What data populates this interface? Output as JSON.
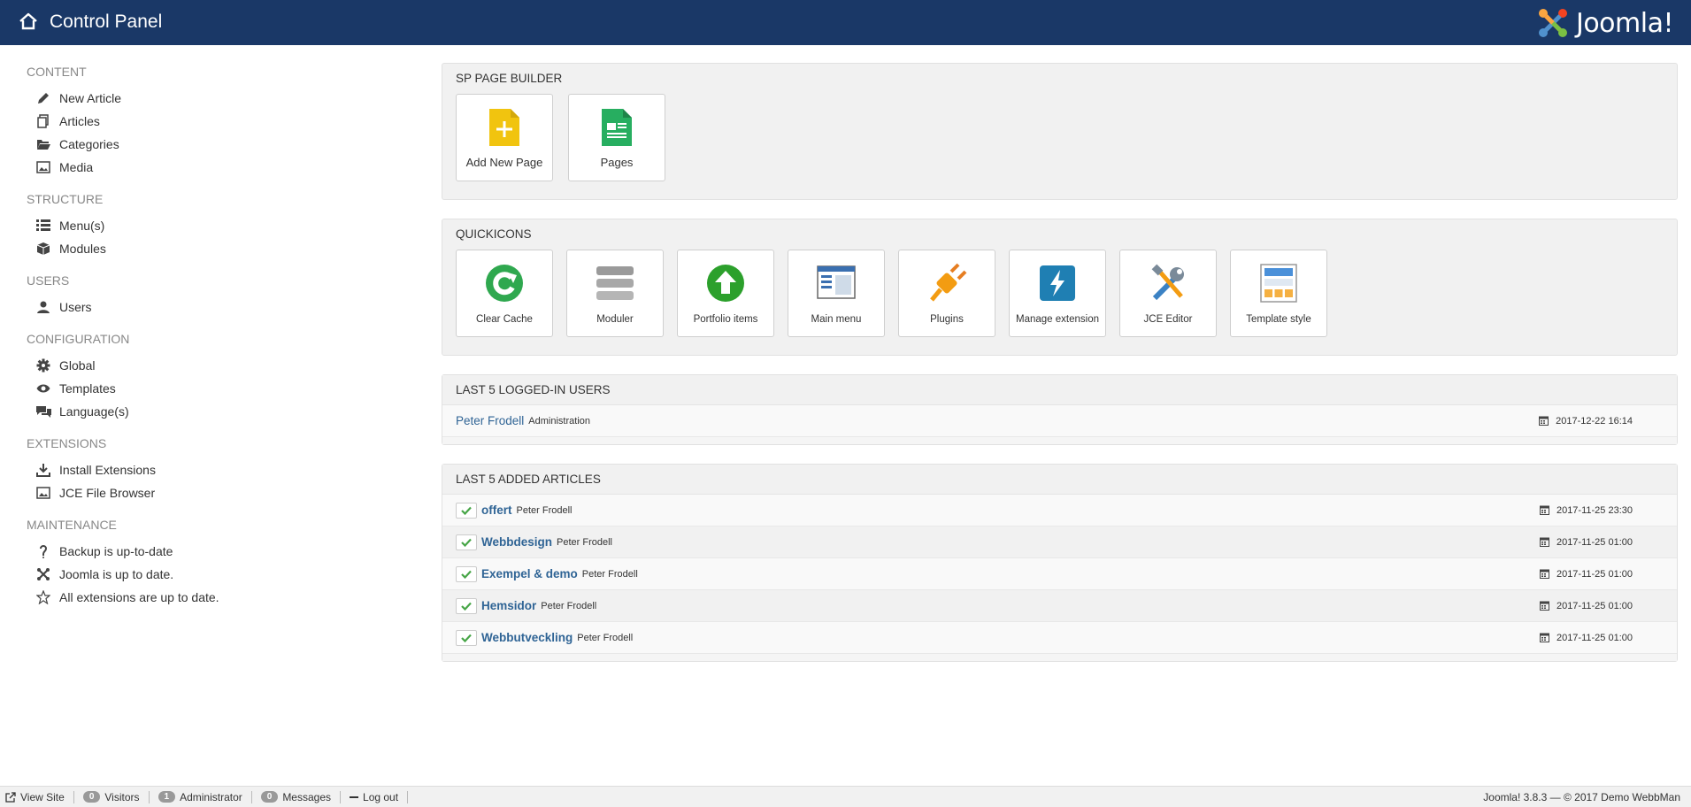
{
  "header": {
    "title": "Control Panel",
    "logo_text": "Joomla!"
  },
  "sidebar": {
    "sections": [
      {
        "title": "CONTENT",
        "items": [
          {
            "label": "New Article",
            "icon": "pencil-icon"
          },
          {
            "label": "Articles",
            "icon": "copy-icon"
          },
          {
            "label": "Categories",
            "icon": "folder-icon"
          },
          {
            "label": "Media",
            "icon": "image-icon"
          }
        ]
      },
      {
        "title": "STRUCTURE",
        "items": [
          {
            "label": "Menu(s)",
            "icon": "list-icon"
          },
          {
            "label": "Modules",
            "icon": "cube-icon"
          }
        ]
      },
      {
        "title": "USERS",
        "items": [
          {
            "label": "Users",
            "icon": "user-icon"
          }
        ]
      },
      {
        "title": "CONFIGURATION",
        "items": [
          {
            "label": "Global",
            "icon": "gear-icon"
          },
          {
            "label": "Templates",
            "icon": "eye-icon"
          },
          {
            "label": "Language(s)",
            "icon": "comments-icon"
          }
        ]
      },
      {
        "title": "EXTENSIONS",
        "items": [
          {
            "label": "Install Extensions",
            "icon": "download-icon"
          },
          {
            "label": "JCE File Browser",
            "icon": "image-icon"
          }
        ]
      },
      {
        "title": "MAINTENANCE",
        "items": [
          {
            "label": "Backup is up-to-date",
            "icon": "akeeba-icon"
          },
          {
            "label": "Joomla is up to date.",
            "icon": "joomla-icon"
          },
          {
            "label": "All extensions are up to date.",
            "icon": "star-icon"
          }
        ]
      }
    ]
  },
  "sp_page_builder": {
    "title": "SP PAGE BUILDER",
    "tiles": [
      {
        "label": "Add New Page",
        "icon": "add-page-icon"
      },
      {
        "label": "Pages",
        "icon": "pages-icon"
      }
    ]
  },
  "quickicons": {
    "title": "QUICKICONS",
    "tiles": [
      {
        "label": "Clear Cache",
        "icon": "refresh-icon"
      },
      {
        "label": "Moduler",
        "icon": "database-icon"
      },
      {
        "label": "Portfolio items",
        "icon": "upload-arrow-icon"
      },
      {
        "label": "Main menu",
        "icon": "window-icon"
      },
      {
        "label": "Plugins",
        "icon": "plug-icon"
      },
      {
        "label": "Manage extension",
        "icon": "lightning-icon"
      },
      {
        "label": "JCE Editor",
        "icon": "tools-icon"
      },
      {
        "label": "Template style",
        "icon": "template-icon"
      }
    ]
  },
  "logged_users": {
    "title": "LAST 5 LOGGED-IN USERS",
    "rows": [
      {
        "name": "Peter Frodell",
        "meta": "Administration",
        "date": "2017-12-22 16:14"
      }
    ]
  },
  "added_articles": {
    "title": "LAST 5 ADDED ARTICLES",
    "rows": [
      {
        "title": "offert",
        "author": "Peter Frodell",
        "date": "2017-11-25 23:30"
      },
      {
        "title": "Webbdesign",
        "author": "Peter Frodell",
        "date": "2017-11-25 01:00"
      },
      {
        "title": "Exempel & demo",
        "author": "Peter Frodell",
        "date": "2017-11-25 01:00"
      },
      {
        "title": "Hemsidor",
        "author": "Peter Frodell",
        "date": "2017-11-25 01:00"
      },
      {
        "title": "Webbutveckling",
        "author": "Peter Frodell",
        "date": "2017-11-25 01:00"
      }
    ]
  },
  "footer": {
    "view_site": "View Site",
    "visitors_count": "0",
    "visitors_label": "Visitors",
    "admin_count": "1",
    "admin_label": "Administrator",
    "messages_count": "0",
    "messages_label": "Messages",
    "logout": "Log out",
    "copyright": "Joomla! 3.8.3  —  © 2017 Demo WebbMan"
  },
  "colors": {
    "header_bg": "#1a3867",
    "link": "#2f6495",
    "well_bg": "#f1f1f1"
  }
}
